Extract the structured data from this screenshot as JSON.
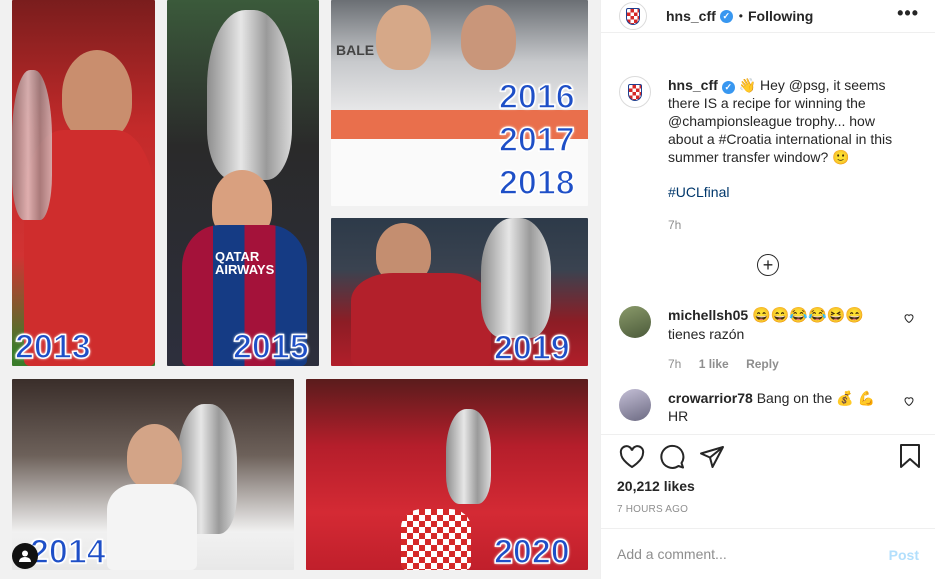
{
  "collage": {
    "years": [
      "2013",
      "2015",
      "2016",
      "2017",
      "2018",
      "2019",
      "2014",
      "2020"
    ],
    "shirt_text_2015": "QATAR AIRWAYS",
    "shirt_text_2016": "BALE"
  },
  "header": {
    "username": "hns_cff",
    "verified_glyph": "✓",
    "separator": "•",
    "follow_status": "Following",
    "more_glyph": "•••"
  },
  "caption": {
    "username": "hns_cff",
    "text": " 👋 Hey @psg, it seems there IS a recipe for winning the @championsleague trophy... how about a #Croatia international in this summer transfer window? 🙂",
    "hashtag": "#UCLfinal",
    "time": "7h",
    "load_more_glyph": "+"
  },
  "comments": [
    {
      "username": "michellsh05",
      "emojis": "😄😄😂😂😆😄",
      "text": "tienes razón",
      "time": "7h",
      "likes": "1 like",
      "reply": "Reply",
      "avatar_color": "#6b7a5a"
    },
    {
      "username": "crowarrior78",
      "text": "Bang on the 💰 💪",
      "text2": "HR",
      "avatar_color": "#a5a0b8"
    }
  ],
  "actions": {
    "like_icon": "heart-icon",
    "comment_icon": "comment-icon",
    "share_icon": "share-icon",
    "save_icon": "bookmark-icon"
  },
  "likes": "20,212 likes",
  "post_time": "7 HOURS AGO",
  "add_comment": {
    "placeholder": "Add a comment...",
    "post_label": "Post",
    "post_color": "#b2dffc"
  }
}
